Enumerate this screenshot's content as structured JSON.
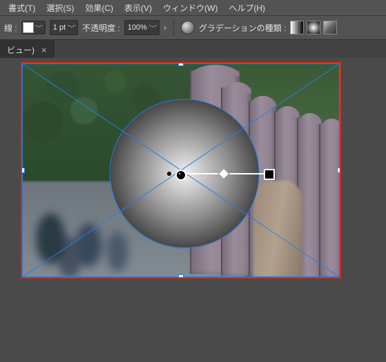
{
  "menu": {
    "items": [
      "書式(T)",
      "選択(S)",
      "効果(C)",
      "表示(V)",
      "ウィンドウ(W)",
      "ヘルプ(H)"
    ]
  },
  "options": {
    "stroke_label": "線 :",
    "stroke_weight": "1 pt",
    "opacity_label": "不透明度 :",
    "opacity_value": "100%",
    "gradient_type_label": "グラデーションの種類 :"
  },
  "tab": {
    "title_suffix": "ビュー)",
    "close": "×"
  },
  "canvas": {
    "bbox_color": "#2a7de1",
    "artboard_border": "#d02a2a"
  }
}
